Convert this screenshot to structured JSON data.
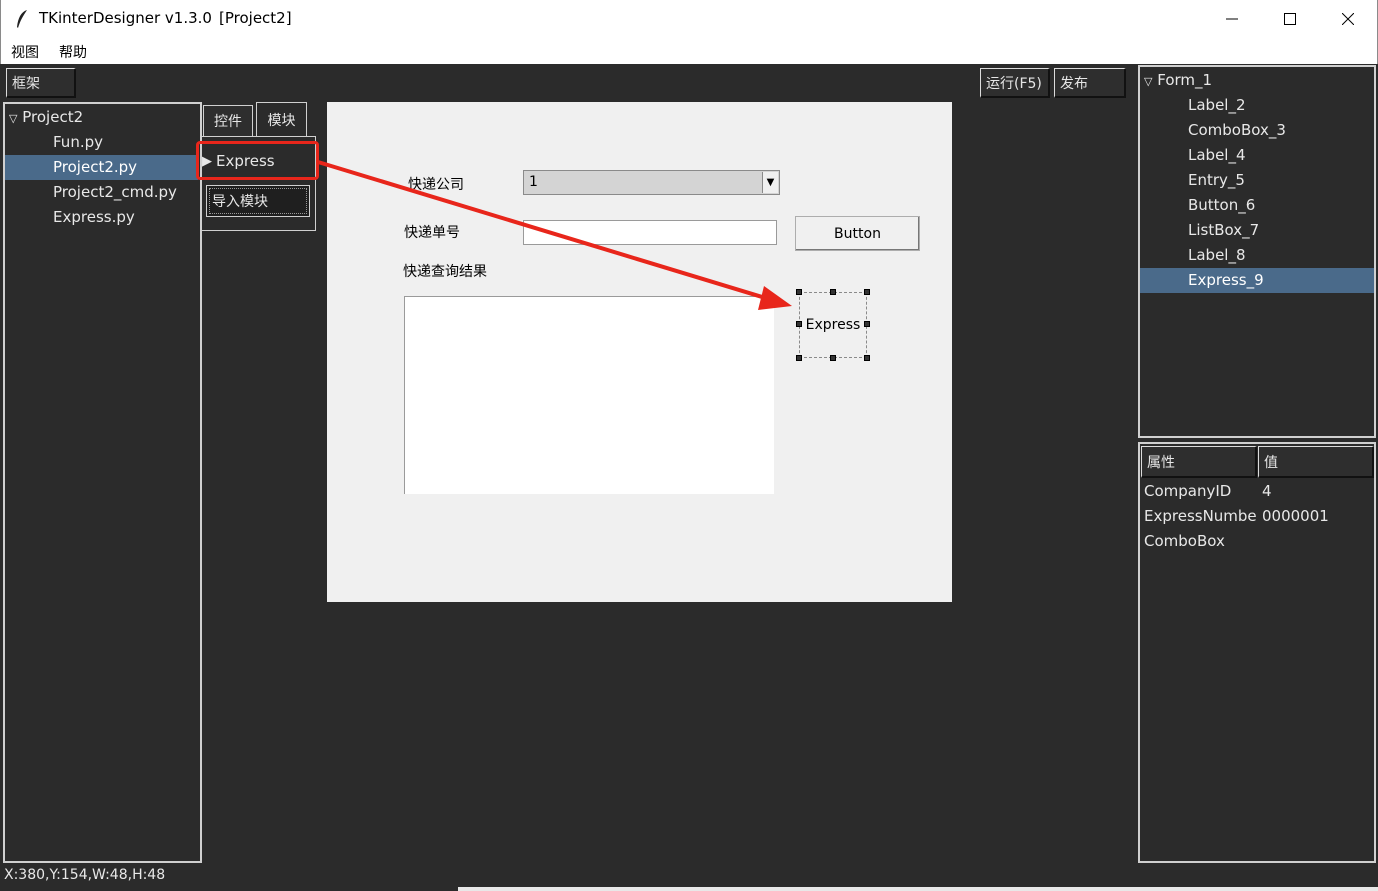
{
  "window": {
    "title": "TKinterDesigner v1.3.0",
    "project_tag": "[Project2]"
  },
  "menu": [
    "视图",
    "帮助"
  ],
  "toolbar": {
    "frame_button": "框架",
    "run_button": "运行(F5)",
    "publish_button": "发布"
  },
  "project_tree": {
    "root": "Project2",
    "files": [
      {
        "label": "Fun.py",
        "selected": false
      },
      {
        "label": "Project2.py",
        "selected": true
      },
      {
        "label": "Project2_cmd.py",
        "selected": false
      },
      {
        "label": "Express.py",
        "selected": false
      }
    ]
  },
  "palette": {
    "tabs": [
      "控件",
      "模块"
    ],
    "active_tab": "模块",
    "module_item": "Express",
    "import_button": "导入模块"
  },
  "form": {
    "label_company": "快递公司",
    "combo_value": "1",
    "label_number": "快递单号",
    "button_label": "Button",
    "label_result": "快递查询结果",
    "express_widget": "Express"
  },
  "widget_tree": {
    "root": "Form_1",
    "items": [
      {
        "label": "Label_2",
        "selected": false
      },
      {
        "label": "ComboBox_3",
        "selected": false
      },
      {
        "label": "Label_4",
        "selected": false
      },
      {
        "label": "Entry_5",
        "selected": false
      },
      {
        "label": "Button_6",
        "selected": false
      },
      {
        "label": "ListBox_7",
        "selected": false
      },
      {
        "label": "Label_8",
        "selected": false
      },
      {
        "label": "Express_9",
        "selected": true
      }
    ]
  },
  "properties": {
    "header_name": "属性",
    "header_value": "值",
    "rows": [
      {
        "name": "CompanyID",
        "value": "4"
      },
      {
        "name": "ExpressNumbe",
        "value": "0000001"
      },
      {
        "name": "ComboBox",
        "value": ""
      }
    ]
  },
  "status": {
    "text": "X:380,Y:154,W:48,H:48"
  },
  "colors": {
    "annotation_red": "#e8261b",
    "selection_blue": "#4a6a8a"
  }
}
